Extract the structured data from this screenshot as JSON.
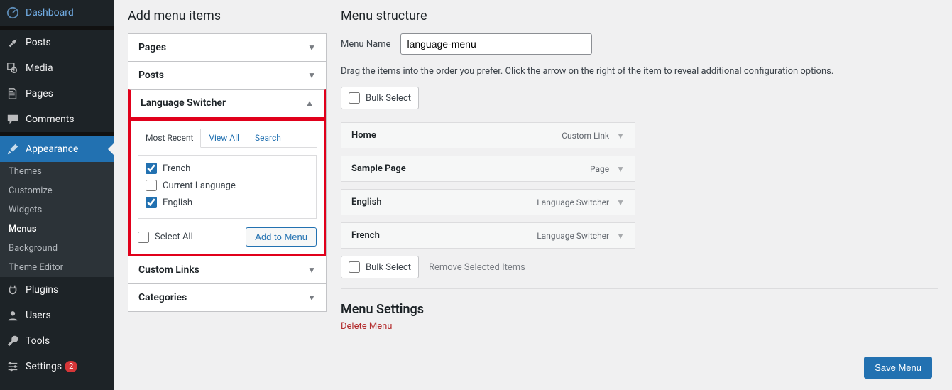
{
  "sidebar": {
    "items": [
      {
        "label": "Dashboard"
      },
      {
        "label": "Posts"
      },
      {
        "label": "Media"
      },
      {
        "label": "Pages"
      },
      {
        "label": "Comments"
      },
      {
        "label": "Appearance"
      },
      {
        "label": "Plugins"
      },
      {
        "label": "Users"
      },
      {
        "label": "Tools"
      },
      {
        "label": "Settings",
        "badge": "2"
      }
    ],
    "appearance_sub": [
      {
        "label": "Themes"
      },
      {
        "label": "Customize"
      },
      {
        "label": "Widgets"
      },
      {
        "label": "Menus"
      },
      {
        "label": "Background"
      },
      {
        "label": "Theme Editor"
      }
    ]
  },
  "addmenu": {
    "heading": "Add menu items",
    "panels": {
      "pages": "Pages",
      "posts": "Posts",
      "langswitcher": "Language Switcher",
      "customlinks": "Custom Links",
      "categories": "Categories"
    },
    "tabs": {
      "recent": "Most Recent",
      "viewall": "View All",
      "search": "Search"
    },
    "options": [
      {
        "label": "French",
        "checked": true
      },
      {
        "label": "Current Language",
        "checked": false
      },
      {
        "label": "English",
        "checked": true
      }
    ],
    "selectall": "Select All",
    "addbtn": "Add to Menu"
  },
  "structure": {
    "heading": "Menu structure",
    "name_label": "Menu Name",
    "name_value": "language-menu",
    "hint": "Drag the items into the order you prefer. Click the arrow on the right of the item to reveal additional configuration options.",
    "bulk": "Bulk Select",
    "remove": "Remove Selected Items",
    "items": [
      {
        "title": "Home",
        "type": "Custom Link"
      },
      {
        "title": "Sample Page",
        "type": "Page"
      },
      {
        "title": "English",
        "type": "Language Switcher"
      },
      {
        "title": "French",
        "type": "Language Switcher"
      }
    ],
    "settings_heading": "Menu Settings",
    "delete": "Delete Menu",
    "save": "Save Menu"
  }
}
